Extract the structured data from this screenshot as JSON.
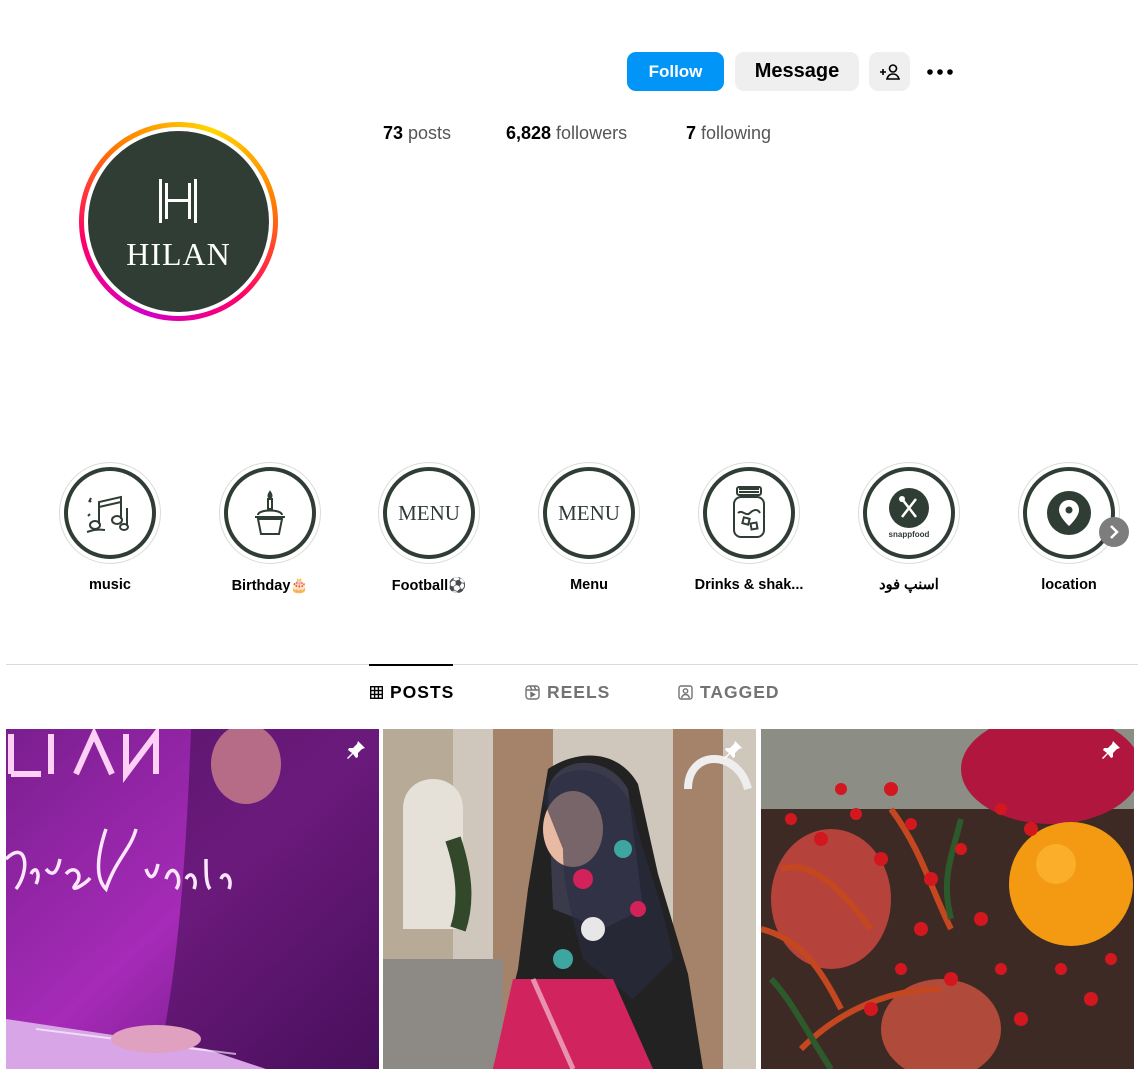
{
  "profile": {
    "name": "HILAN",
    "logo_letter": "H"
  },
  "actions": {
    "follow": "Follow",
    "message": "Message"
  },
  "stats": {
    "posts_count": "73",
    "posts_label": "posts",
    "followers_count": "6,828",
    "followers_label": "followers",
    "following_count": "7",
    "following_label": "following"
  },
  "highlights": [
    {
      "label": "music",
      "icon": "music-notes-icon"
    },
    {
      "label": "Birthday🎂",
      "icon": "cupcake-icon"
    },
    {
      "label": "Football⚽",
      "icon": "menu-text",
      "text": "MENU"
    },
    {
      "label": "Menu",
      "icon": "menu-text",
      "text": "MENU"
    },
    {
      "label": "Drinks & shak...",
      "icon": "jar-icon"
    },
    {
      "label": "اسنپ فود",
      "icon": "snappfood-icon",
      "text": "snappfood"
    },
    {
      "label": "location",
      "icon": "location-pin-icon"
    }
  ],
  "tabs": {
    "posts": "POSTS",
    "reels": "REELS",
    "tagged": "TAGGED"
  },
  "colors": {
    "brand": "#2f3d35",
    "follow": "#0095f6"
  }
}
